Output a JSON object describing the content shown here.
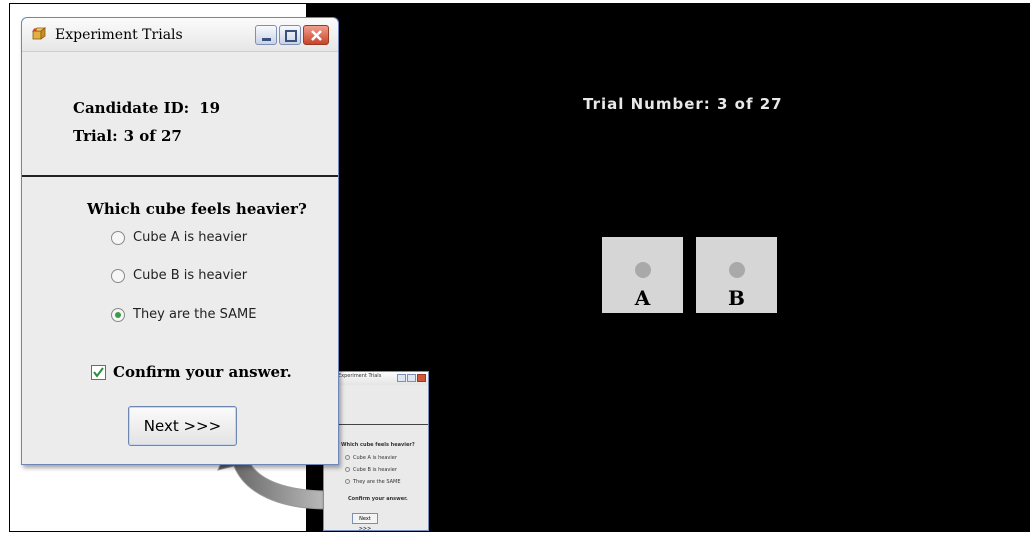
{
  "dialog": {
    "title": "Experiment Trials",
    "candidate_label": "Candidate ID:",
    "candidate_value": "19",
    "trial_label": "Trial:",
    "trial_value": "3 of 27",
    "question": "Which cube feels heavier?",
    "options": [
      {
        "label": "Cube A is heavier",
        "selected": false
      },
      {
        "label": "Cube B is heavier",
        "selected": false
      },
      {
        "label": "They are the SAME",
        "selected": true
      }
    ],
    "confirm_label": "Confirm your answer.",
    "confirm_checked": true,
    "next_label": "Next >>>"
  },
  "stimulus": {
    "heading": "Trial Number: 3 of 27",
    "cubes": [
      {
        "label": "A"
      },
      {
        "label": "B"
      }
    ]
  },
  "colors": {
    "stimulus_background": "#000000",
    "cube_fill": "#d6d6d6",
    "dot_fill": "#a9a9a9",
    "radio_selected": "#3f9a45",
    "close_button": "#c7442a"
  }
}
